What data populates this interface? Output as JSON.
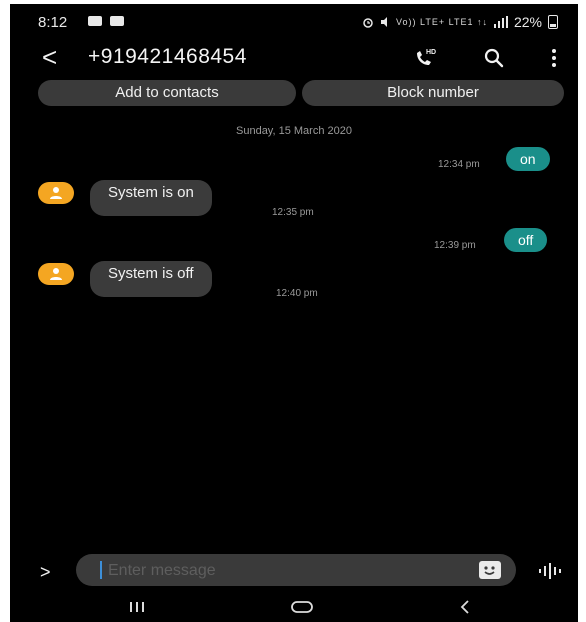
{
  "status_bar": {
    "time": "8:12",
    "signal_text": "Vo)) LTE+ LTE1 ↑↓",
    "battery": "22%"
  },
  "header": {
    "back_label": "<",
    "phone_number": "+919421468454",
    "icons": [
      "hd-call-icon",
      "search-icon",
      "more-options-icon"
    ]
  },
  "actions": {
    "add_contact": "Add to contacts",
    "block_number": "Block number"
  },
  "conversation": {
    "date": "Sunday, 15 March 2020",
    "messages": [
      {
        "direction": "sent",
        "text": "on",
        "time": "12:34 pm"
      },
      {
        "direction": "received",
        "text": "System is on",
        "time": "12:35 pm"
      },
      {
        "direction": "sent",
        "text": "off",
        "time": "12:39 pm"
      },
      {
        "direction": "received",
        "text": "System is off",
        "time": "12:40 pm"
      }
    ]
  },
  "composer": {
    "expand_label": ">",
    "placeholder": "Enter message",
    "value": ""
  },
  "colors": {
    "background": "#000000",
    "sent_bubble": "#1a8f8a",
    "received_bubble": "#3b3b3b",
    "avatar": "#f4a622",
    "cursor": "#3d8fd8"
  }
}
